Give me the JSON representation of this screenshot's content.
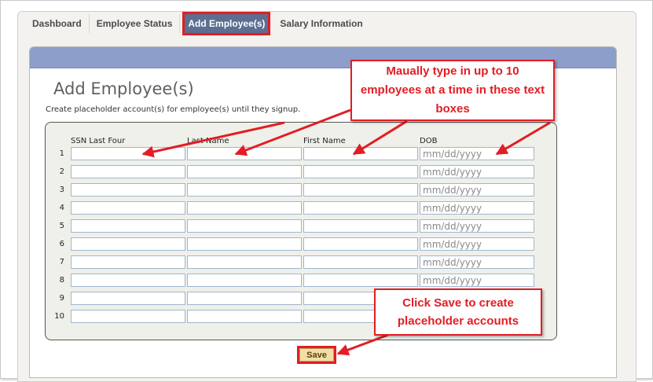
{
  "tabs": [
    {
      "label": "Dashboard",
      "active": false
    },
    {
      "label": "Employee Status",
      "active": false
    },
    {
      "label": "Add Employee(s)",
      "active": true
    },
    {
      "label": "Salary Information",
      "active": false
    }
  ],
  "page": {
    "title": "Add Employee(s)",
    "subtitle": "Create placeholder account(s) for employee(s) until they signup."
  },
  "table": {
    "headers": [
      "SSN Last Four",
      "Last Name",
      "First Name",
      "DOB"
    ],
    "rows": [
      "1",
      "2",
      "3",
      "4",
      "5",
      "6",
      "7",
      "8",
      "9",
      "10"
    ],
    "dob_placeholder": "mm/dd/yyyy"
  },
  "save_label": "Save",
  "callouts": {
    "type_hint": "Maually type in up to 10 employees at a time in these text boxes",
    "save_hint": "Click Save to create placeholder accounts"
  },
  "colors": {
    "accent_red": "#e21d24",
    "tab_active": "#5c6e91",
    "band": "#8c9ec9",
    "save_button": "#f2dfa5"
  }
}
